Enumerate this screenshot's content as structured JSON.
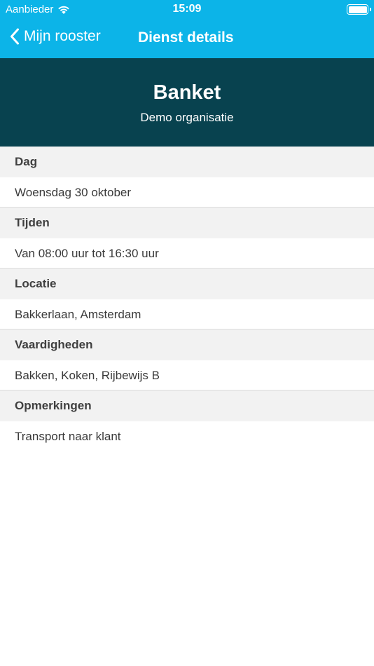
{
  "status_bar": {
    "carrier": "Aanbieder",
    "time": "15:09"
  },
  "nav": {
    "back_label": "Mijn rooster",
    "title": "Dienst details"
  },
  "header": {
    "title": "Banket",
    "subtitle": "Demo organisatie"
  },
  "sections": [
    {
      "label": "Dag",
      "value": "Woensdag 30 oktober"
    },
    {
      "label": "Tijden",
      "value": "Van 08:00 uur tot 16:30 uur"
    },
    {
      "label": "Locatie",
      "value": "Bakkerlaan, Amsterdam"
    },
    {
      "label": "Vaardigheden",
      "value": "Bakken, Koken, Rijbewijs B"
    },
    {
      "label": "Opmerkingen",
      "value": "Transport naar klant"
    }
  ],
  "colors": {
    "nav_blue": "#0cb4e8",
    "header_dark": "#08424f",
    "section_bg": "#f2f2f2"
  }
}
